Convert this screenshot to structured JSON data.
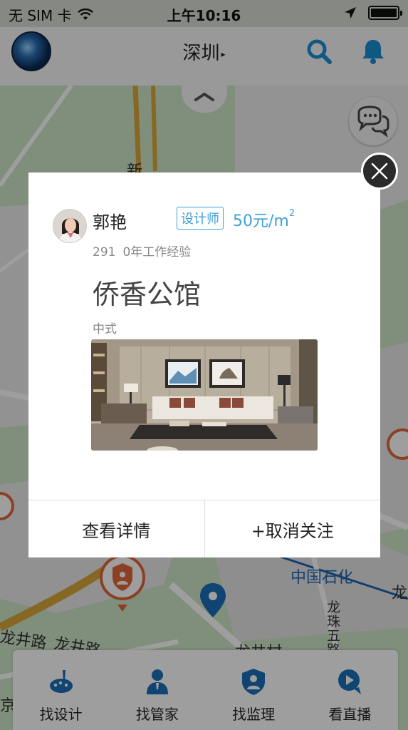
{
  "status_bar": {
    "carrier": "无 SIM 卡",
    "time": "上午10:16",
    "icons": [
      "wifi-icon",
      "location-arrow-icon",
      "battery-icon"
    ]
  },
  "nav_bar": {
    "city": "深圳",
    "city_arrow": "▸",
    "icons": [
      "app-logo-avatar",
      "search-icon",
      "bell-icon"
    ],
    "accent_color": "#1b8fd6"
  },
  "map": {
    "labels": {
      "xin": "新",
      "sinopec": "中国石化",
      "longjing_road_1": "龙井路",
      "longjing_road_2": "龙井路",
      "longzhu_road": "龙珠五路",
      "longjing_village": "龙井村",
      "long_right": "龙",
      "jing_left": "京"
    },
    "icons": [
      "map-pin-icon",
      "supervisor-marker-icon",
      "chat-bubble-icon"
    ]
  },
  "card": {
    "designer_name": "郭艳",
    "role": "设计师",
    "price": "50元/m",
    "price_unit_exp": "2",
    "follower_count": "291",
    "experience": "0年工作经验",
    "project_title": "侨香公馆",
    "style": "中式",
    "actions": {
      "view_details": "查看详情",
      "unfollow": "+取消关注"
    },
    "accent_color": "#3fa0d8"
  },
  "tab_bar": {
    "items": [
      {
        "label": "找设计",
        "icon": "palette-icon"
      },
      {
        "label": "找管家",
        "icon": "butler-icon"
      },
      {
        "label": "找监理",
        "icon": "shield-person-icon"
      },
      {
        "label": "看直播",
        "icon": "live-play-icon"
      }
    ],
    "icon_color": "#1b6fb8"
  }
}
